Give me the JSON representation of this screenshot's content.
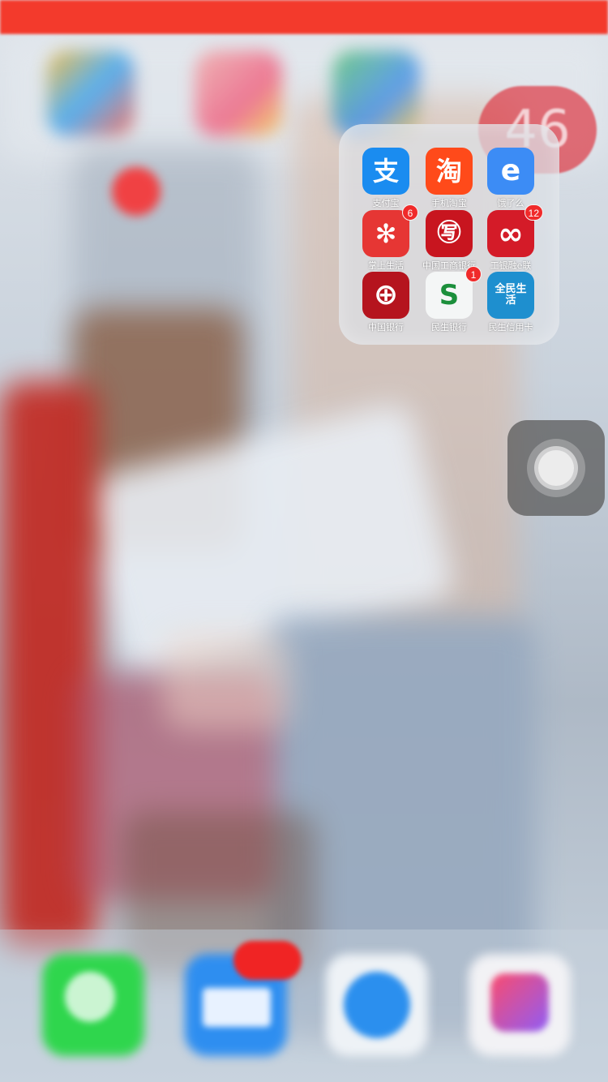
{
  "folder": {
    "count": "46",
    "apps": [
      {
        "label": "支付宝",
        "glyph": "支",
        "bg": "#1a8cf0",
        "badge": "",
        "icon": "alipay-icon"
      },
      {
        "label": "手机淘宝",
        "glyph": "淘",
        "bg": "#ff4a1a",
        "badge": "",
        "icon": "taobao-icon"
      },
      {
        "label": "饿了么",
        "glyph": "e",
        "bg": "#3c8cf5",
        "badge": "",
        "icon": "eleme-icon"
      },
      {
        "label": "掌上生活",
        "glyph": "✻",
        "bg": "#e63634",
        "badge": "6",
        "icon": "cmb-life-icon"
      },
      {
        "label": "中国工商银行",
        "glyph": "㊢",
        "bg": "#c8151f",
        "badge": "",
        "icon": "icbc-icon"
      },
      {
        "label": "工银融e联",
        "glyph": "∞",
        "bg": "#d41b28",
        "badge": "12",
        "icon": "icbc-elink-icon"
      },
      {
        "label": "中国银行",
        "glyph": "⊕",
        "bg": "#b5141e",
        "badge": "",
        "icon": "boc-icon"
      },
      {
        "label": "民生银行",
        "glyph": "S",
        "bg": "#f4f6f6",
        "badge": "1",
        "icon": "cmbc-icon"
      },
      {
        "label": "民生信用卡",
        "glyph": "全民生活",
        "bg": "#1e8fcf",
        "badge": "",
        "icon": "cmbc-credit-icon"
      }
    ]
  },
  "dock": [
    "phone-icon",
    "mail-icon",
    "safari-icon",
    "music-icon"
  ]
}
